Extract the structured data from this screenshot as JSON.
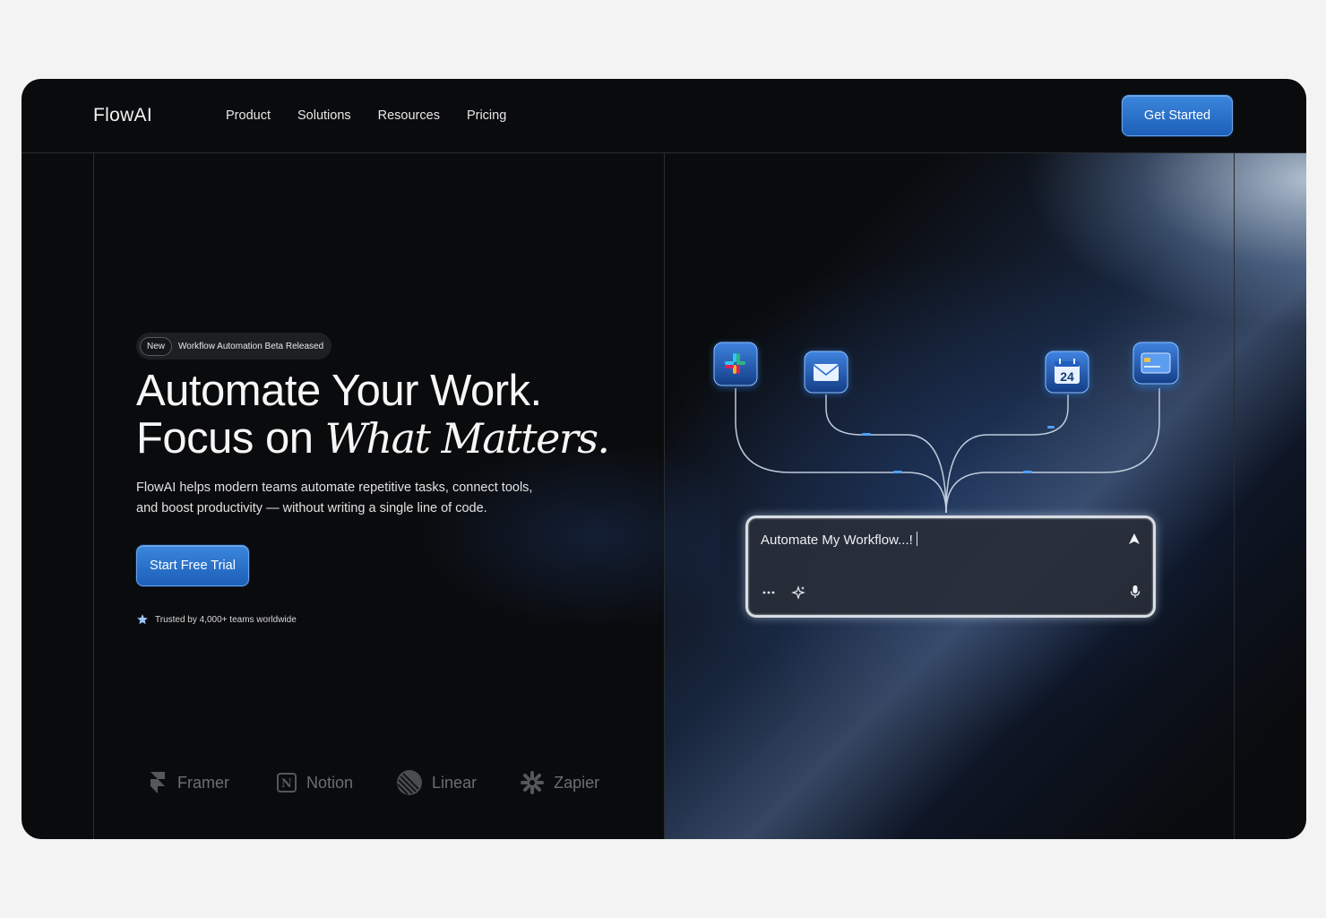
{
  "nav": {
    "logo": "FlowAI",
    "links": [
      "Product",
      "Solutions",
      "Resources",
      "Pricing"
    ],
    "cta": "Get Started"
  },
  "hero": {
    "badge_new": "New",
    "badge_text": "Workflow Automation Beta Released",
    "headline_line1": "Automate Your Work.",
    "headline_line2_plain": "Focus on ",
    "headline_line2_italic": "What Matters.",
    "subtext": "FlowAI helps modern teams automate repetitive tasks, connect tools, and boost productivity — without writing a single line of code.",
    "cta": "Start Free Trial",
    "trusted": "Trusted by 4,000+ teams worldwide"
  },
  "partner_logos": [
    "Framer",
    "Notion",
    "Linear",
    "Zapier"
  ],
  "prompt": {
    "text": "Automate My Workflow...!"
  },
  "integrations": {
    "apps": [
      "slack-icon",
      "mail-icon",
      "calendar-icon",
      "credit-card-icon"
    ],
    "calendar_day": "24"
  },
  "colors": {
    "accent": "#2a72cc",
    "background": "#0a0b0d",
    "page_bg": "#f3f3f3"
  }
}
